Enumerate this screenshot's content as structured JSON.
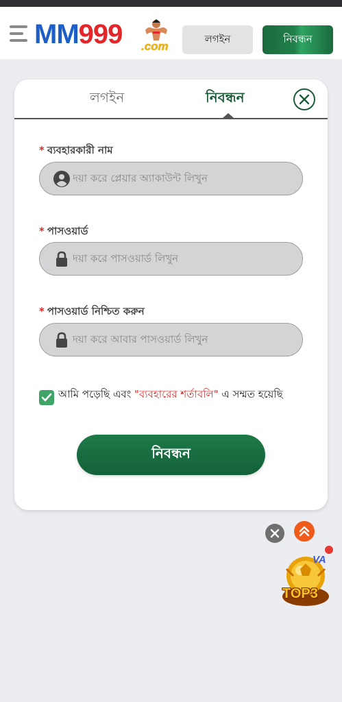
{
  "header": {
    "logo_text_blue": "MM",
    "logo_text_red": "999",
    "logo_com": ".com",
    "login_button": "লগইন",
    "register_button": "নিবন্ধন"
  },
  "modal": {
    "tabs": [
      {
        "label": "লগইন",
        "active": false
      },
      {
        "label": "নিবন্ধন",
        "active": true
      }
    ],
    "fields": [
      {
        "label": "ব্যবহারকারী নাম",
        "placeholder": "দয়া করে প্লেয়ার অ্যাকাউন্ট লিখুন",
        "icon": "user-icon",
        "required_mark": "*"
      },
      {
        "label": "পাসওয়ার্ড",
        "placeholder": "দয়া করে পাসওয়ার্ড লিখুন",
        "icon": "lock-icon",
        "required_mark": "*"
      },
      {
        "label": "পাসওয়ার্ড নিশ্চিত করুন",
        "placeholder": "দয়া করে আবার পাসওয়ার্ড লিখুন",
        "icon": "lock-icon",
        "required_mark": "*"
      }
    ],
    "agreement": {
      "checked": true,
      "prefix": "আমি পড়েছি এবং ",
      "link": "\"ব্যবহারের শর্তাবলি\"",
      "suffix": " এ সম্মত হয়েছি"
    },
    "submit_label": "নিবন্ধন"
  },
  "floating": {
    "badge_text": "TOP3",
    "vip_text": "VA"
  },
  "colors": {
    "primary_green": "#1a5c37",
    "logo_blue": "#1e5fc7",
    "logo_red": "#e3262a",
    "required_red": "#d32f2f",
    "scroll_top_orange": "#f05a1a"
  }
}
